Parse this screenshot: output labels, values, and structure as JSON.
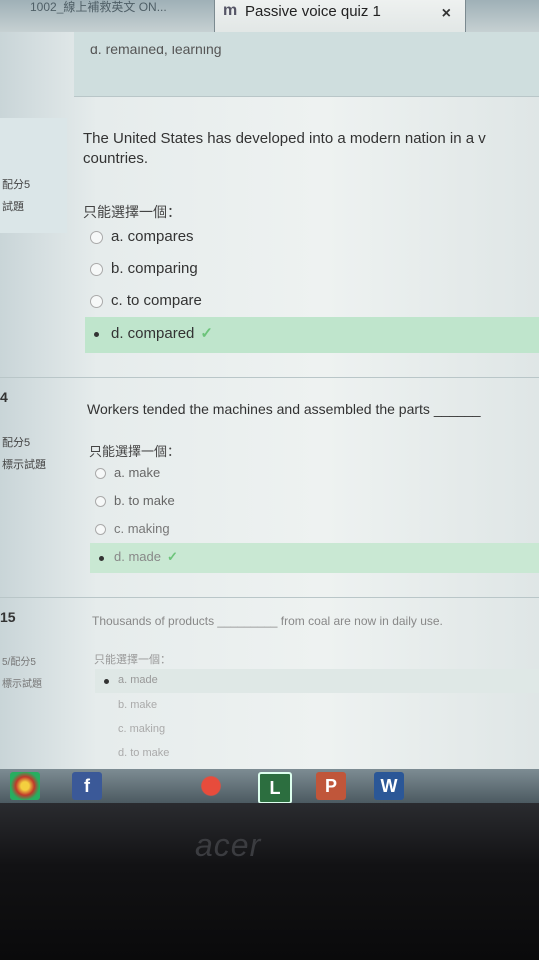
{
  "browser": {
    "prev_tab_label": "1002_線上補救英文 ON...",
    "active_tab_favicon": "m",
    "active_tab_title": "Passive voice quiz 1",
    "close_glyph": "×"
  },
  "partial_option_top": "d. remained, learning",
  "questions": [
    {
      "number": "",
      "score_label": "配分5",
      "flag_label": "試題",
      "text_line1": "The United States has developed into a modern nation in a v",
      "text_line2": "countries.",
      "prompt": "只能選擇一個：",
      "options": [
        {
          "label": "a. compares",
          "selected": false
        },
        {
          "label": "b. comparing",
          "selected": false
        },
        {
          "label": "c. to compare",
          "selected": false
        },
        {
          "label": "d. compared",
          "selected": true,
          "correct": true
        }
      ]
    },
    {
      "number": "4",
      "score_label": "配分5",
      "flag_label": "標示試題",
      "text_line1": "Workers tended the machines and assembled the parts ______",
      "prompt": "只能選擇一個：",
      "options": [
        {
          "label": "a. make",
          "selected": false
        },
        {
          "label": "b. to make",
          "selected": false
        },
        {
          "label": "c. making",
          "selected": false
        },
        {
          "label": "d. made",
          "selected": true,
          "correct": true
        }
      ]
    },
    {
      "number": "15",
      "score_label": "5/配分5",
      "flag_label": "標示試題",
      "text_line1": "Thousands of products _________ from coal are now in daily use.",
      "prompt": "只能選擇一個：",
      "options": [
        {
          "label": "a. made",
          "selected": true
        },
        {
          "label": "b. make",
          "selected": false
        },
        {
          "label": "c. making",
          "selected": false
        },
        {
          "label": "d. to make",
          "selected": false
        }
      ]
    }
  ],
  "checkmark": "✓",
  "taskbar": {
    "apps": [
      {
        "icon": "chrome-icon",
        "label": ""
      },
      {
        "icon": "facebook-icon",
        "label": "f"
      },
      {
        "icon": "bag-icon",
        "label": ""
      },
      {
        "icon": "line-icon",
        "label": "L"
      },
      {
        "icon": "powerpoint-icon",
        "label": "P"
      },
      {
        "icon": "word-icon",
        "label": "W"
      }
    ]
  },
  "bezel_brand": "acer"
}
